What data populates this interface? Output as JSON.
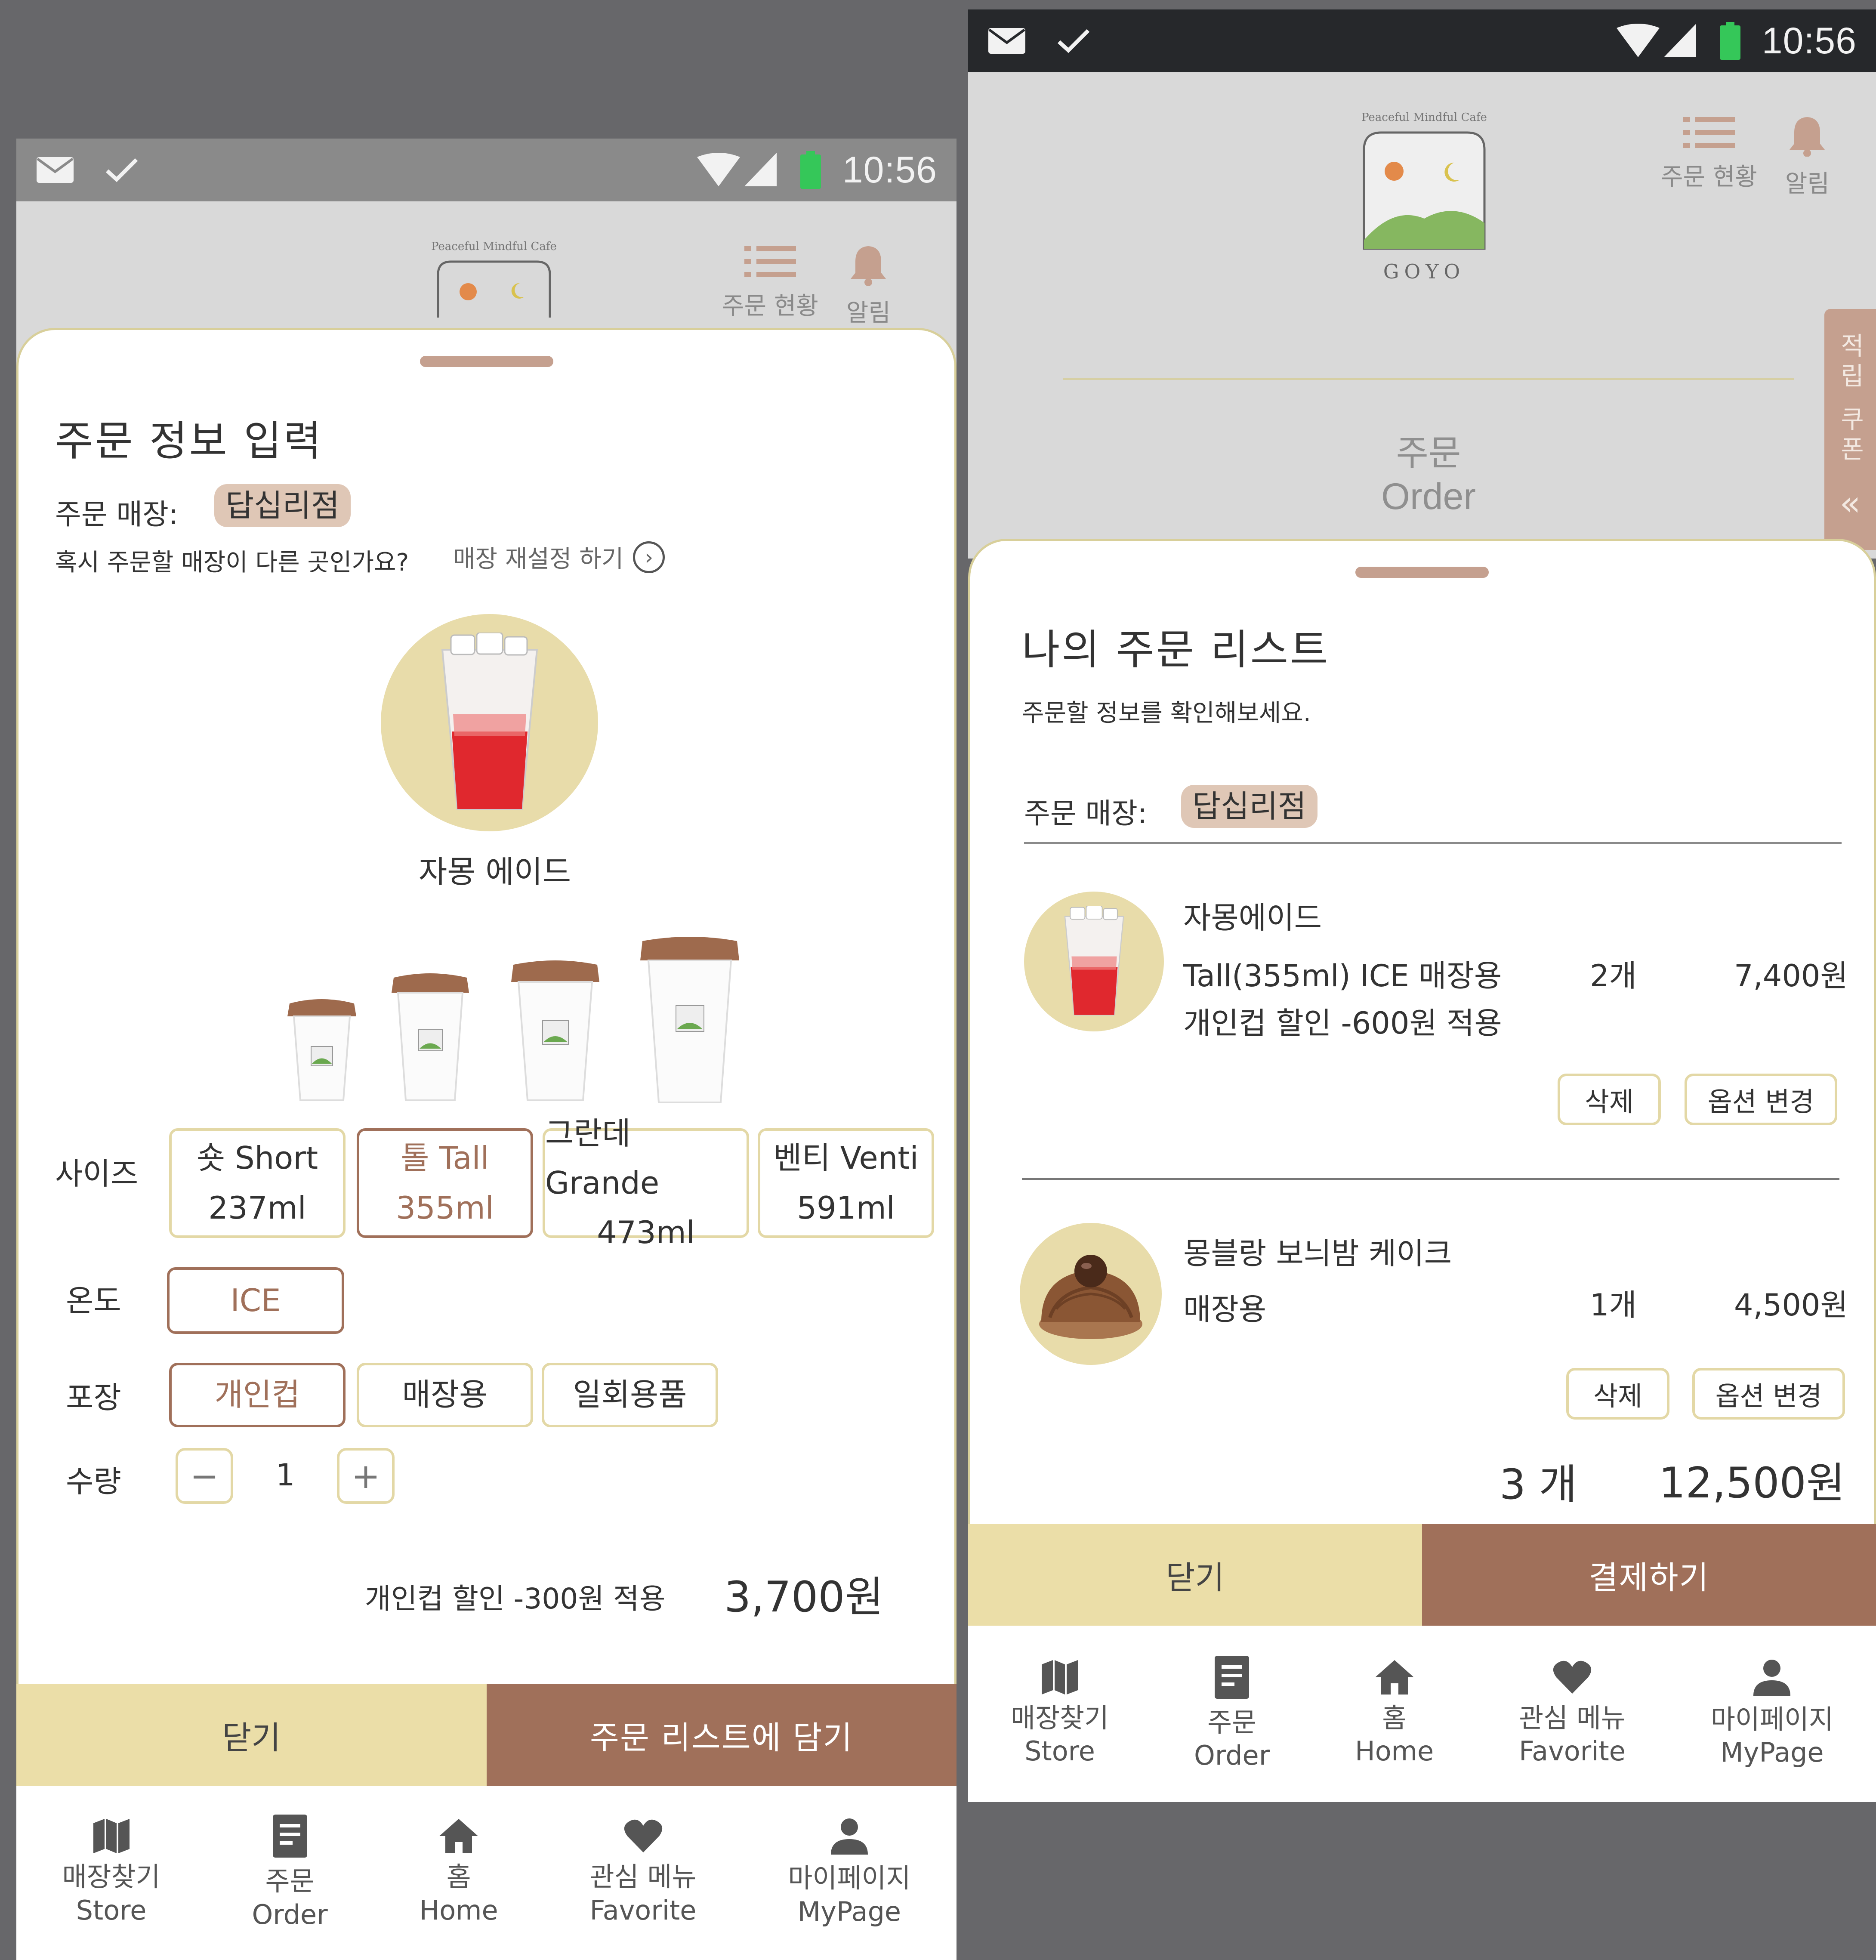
{
  "status_bar": {
    "time": "10:56"
  },
  "header": {
    "logo_tagline": "Peaceful Mindful Cafe",
    "logo_word": "GOYO",
    "order_status_label": "주문 현황",
    "alert_label": "알림"
  },
  "order_banner": {
    "ko": "주문",
    "en": "Order"
  },
  "side_tab": {
    "text": "적립 쿠폰",
    "arrow": "«"
  },
  "order_form": {
    "title": "주문 정보 입력",
    "store_label": "주문 매장:",
    "store_name": "답십리점",
    "change_question": "혹시 주문할 매장이 다른 곳인가요?",
    "change_link": "매장 재설정 하기",
    "product_name": "자몽 에이드",
    "size_label": "사이즈",
    "sizes": [
      {
        "name": "숏 Short",
        "volume": "237ml"
      },
      {
        "name": "톨 Tall",
        "volume": "355ml"
      },
      {
        "name": "그란데 Grande",
        "volume": "473ml"
      },
      {
        "name": "벤티 Venti",
        "volume": "591ml"
      }
    ],
    "temp_label": "온도",
    "temp_option": "ICE",
    "pack_label": "포장",
    "pack_options": [
      "개인컵",
      "매장용",
      "일회용품"
    ],
    "qty_label": "수량",
    "qty_minus": "−",
    "qty_value": "1",
    "qty_plus": "+",
    "discount_text": "개인컵 할인 -300원 적용",
    "price": "3,700원",
    "close_label": "닫기",
    "add_label": "주문 리스트에 담기"
  },
  "order_list": {
    "title": "나의 주문 리스트",
    "subtitle": "주문할 정보를 확인해보세요.",
    "store_label": "주문 매장:",
    "store_name": "답십리점",
    "items": [
      {
        "name": "자몽에이드",
        "option": "Tall(355ml)   ICE   매장용",
        "qty": "2개",
        "price": "7,400원",
        "note": "개인컵 할인 -600원 적용",
        "delete_label": "삭제",
        "change_label": "옵션 변경"
      },
      {
        "name": "몽블랑 보늬밤 케이크",
        "option": "매장용",
        "qty": "1개",
        "price": "4,500원",
        "delete_label": "삭제",
        "change_label": "옵션 변경"
      }
    ],
    "total_count": "3 개",
    "total_price": "12,500원",
    "close_label": "닫기",
    "pay_label": "결제하기"
  },
  "nav": [
    {
      "ko": "매장찾기",
      "en": "Store",
      "icon": "map-icon"
    },
    {
      "ko": "주문",
      "en": "Order",
      "icon": "receipt-icon"
    },
    {
      "ko": "홈",
      "en": "Home",
      "icon": "home-icon"
    },
    {
      "ko": "관심 메뉴",
      "en": "Favorite",
      "icon": "heart-icon"
    },
    {
      "ko": "마이페이지",
      "en": "MyPage",
      "icon": "person-icon"
    }
  ]
}
